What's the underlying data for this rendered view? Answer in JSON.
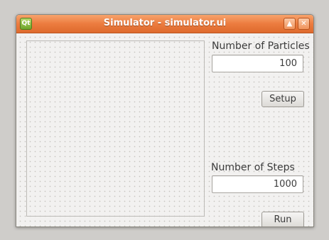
{
  "window": {
    "title": "Simulator - simulator.ui",
    "icon_text": "Qt",
    "icons": {
      "app": "qt-logo-icon",
      "maximize": "maximize-icon",
      "close": "close-icon"
    },
    "accent_color": "#ec7c3f"
  },
  "controls": {
    "particles_label": "Number of Particles",
    "particles_value": "100",
    "setup_label": "Setup",
    "steps_label": "Number of Steps",
    "steps_value": "1000",
    "run_label": "Run"
  }
}
